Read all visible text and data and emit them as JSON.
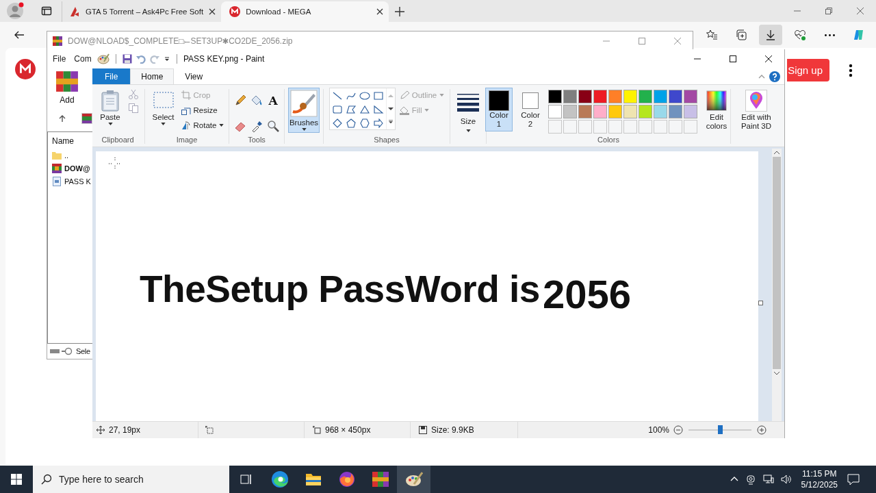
{
  "browser": {
    "tabs": [
      {
        "title": "GTA 5 Torrent – Ask4Pc Free Soft",
        "kind": "torrent",
        "selected": false
      },
      {
        "title": "Download - MEGA",
        "kind": "mega",
        "selected": true
      }
    ],
    "toolbar_buttons": [
      {
        "kind": "favorites",
        "selected": false
      },
      {
        "kind": "collections",
        "selected": false
      },
      {
        "kind": "downloads",
        "selected": true
      },
      {
        "kind": "health",
        "selected": false
      },
      {
        "kind": "more",
        "selected": false
      },
      {
        "kind": "copilot",
        "selected": false
      }
    ],
    "signup_button": "Sign up"
  },
  "archiver": {
    "title": "DOW@NLOAD$_COMPLETE□⤚SET3UP✱CO2DE_2056.zip",
    "menu": [
      "File",
      "Com"
    ],
    "toolbar": [
      "Add"
    ],
    "column": "Name",
    "files": [
      {
        "name": "..",
        "kind": "folder",
        "bold": false
      },
      {
        "name": "DOW@",
        "kind": "archive",
        "bold": true
      },
      {
        "name": "PASS K",
        "kind": "image",
        "bold": false
      }
    ],
    "status": "Sele"
  },
  "paint": {
    "title": "PASS KEY.png - Paint",
    "tabs": [
      {
        "label": "File",
        "selected": false
      },
      {
        "label": "Home",
        "selected": true
      },
      {
        "label": "View",
        "selected": false
      }
    ],
    "clipboard": {
      "label": "Clipboard",
      "paste": "Paste"
    },
    "image": {
      "label": "Image",
      "select": "Select",
      "tools": [
        {
          "label": "Crop",
          "kind": "crop",
          "disabled": true
        },
        {
          "label": "Resize",
          "kind": "resize",
          "disabled": false
        },
        {
          "label": "Rotate",
          "kind": "rotate",
          "disabled": false
        }
      ]
    },
    "tools": {
      "label": "Tools",
      "text_glyph": "A"
    },
    "brushes": {
      "label": "Brushes",
      "selected": true
    },
    "shapes": {
      "label": "Shapes",
      "outline": {
        "label": "Outline",
        "disabled": true
      },
      "fill": {
        "label": "Fill",
        "disabled": true
      }
    },
    "size": "Size",
    "colors": {
      "label": "Colors",
      "primary": {
        "label": "Color 1",
        "color": "#000000",
        "selected": true
      },
      "secondary": {
        "label": "Color 2",
        "color": "#ffffff",
        "selected": false
      },
      "palette": [
        {
          "color": "#000000"
        },
        {
          "color": "#7f7f7f"
        },
        {
          "color": "#880015"
        },
        {
          "color": "#ed1c24"
        },
        {
          "color": "#ff7f27"
        },
        {
          "color": "#fff200"
        },
        {
          "color": "#22b14c"
        },
        {
          "color": "#00a2e8"
        },
        {
          "color": "#3f48cc"
        },
        {
          "color": "#a349a4"
        },
        {
          "color": "#ffffff"
        },
        {
          "color": "#c3c3c3"
        },
        {
          "color": "#b97a57"
        },
        {
          "color": "#ffaec9"
        },
        {
          "color": "#ffc90e"
        },
        {
          "color": "#efe4b0"
        },
        {
          "color": "#b5e61d"
        },
        {
          "color": "#99d9ea"
        },
        {
          "color": "#7092be"
        },
        {
          "color": "#c8bfe7"
        }
      ],
      "edit_colors": "Edit colors"
    },
    "paint3d": "Edit with Paint 3D",
    "canvas": {
      "text": "TheSetup PassWord is",
      "code": "2056"
    },
    "status": {
      "position": "27, 19px",
      "dimensions": "968 × 450px",
      "file_size": "Size: 9.9KB",
      "zoom": "100%",
      "zoom_slider": {
        "level": 0.5
      }
    }
  },
  "taskbar": {
    "search_placeholder": "Type here to search",
    "apps": [
      {
        "kind": "task-view",
        "selected": false
      },
      {
        "kind": "edge",
        "selected": false
      },
      {
        "kind": "explorer",
        "selected": false
      },
      {
        "kind": "firefox",
        "selected": false
      },
      {
        "kind": "winrar",
        "selected": false
      },
      {
        "kind": "paint",
        "selected": true
      }
    ],
    "time": "11:15 PM",
    "date": "5/12/2025"
  }
}
